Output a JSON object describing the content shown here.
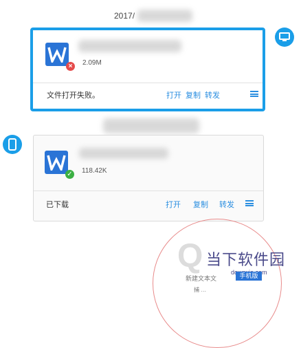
{
  "chat": {
    "date": "2017/",
    "messages": [
      {
        "file_size": "2.09M",
        "status_text": "文件打开失败。",
        "status_icon": "error-badge-icon",
        "actions": {
          "open": "打开",
          "copy": "复制",
          "forward": "转发"
        }
      },
      {
        "file_size": "118.42K",
        "status_text": "已下载",
        "status_icon": "success-badge-icon",
        "actions": {
          "open": "打开",
          "copy": "复制",
          "forward": "转发"
        }
      }
    ]
  },
  "watermark": {
    "text": "当下软件园",
    "domain": "downxia.com",
    "pill": "手机版",
    "small_text": "新建文本文",
    "small_text2": "捕 …"
  },
  "colors": {
    "accent": "#1a9ee8",
    "file_icon": "#2a74d6",
    "link": "#2a8ee0",
    "error": "#e54b4b",
    "success": "#3cb043"
  }
}
